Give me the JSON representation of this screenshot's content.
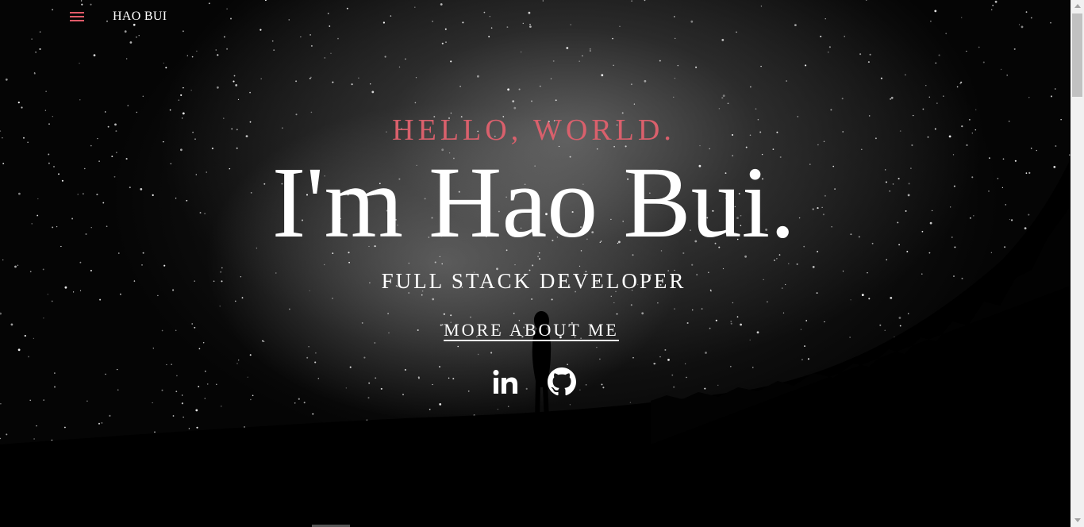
{
  "nav": {
    "menu_icon": "hamburger-menu-icon",
    "brand": "HAO BUI"
  },
  "hero": {
    "greeting": "HELLO, WORLD.",
    "title": "I'm Hao Bui.",
    "subtitle": "FULL STACK DEVELOPER",
    "cta": "MORE ABOUT ME"
  },
  "socials": [
    {
      "name": "linkedin",
      "icon": "linkedin-icon"
    },
    {
      "name": "github",
      "icon": "github-icon"
    }
  ],
  "colors": {
    "accent": "#d9606c",
    "text": "#ffffff",
    "background": "#000000"
  }
}
